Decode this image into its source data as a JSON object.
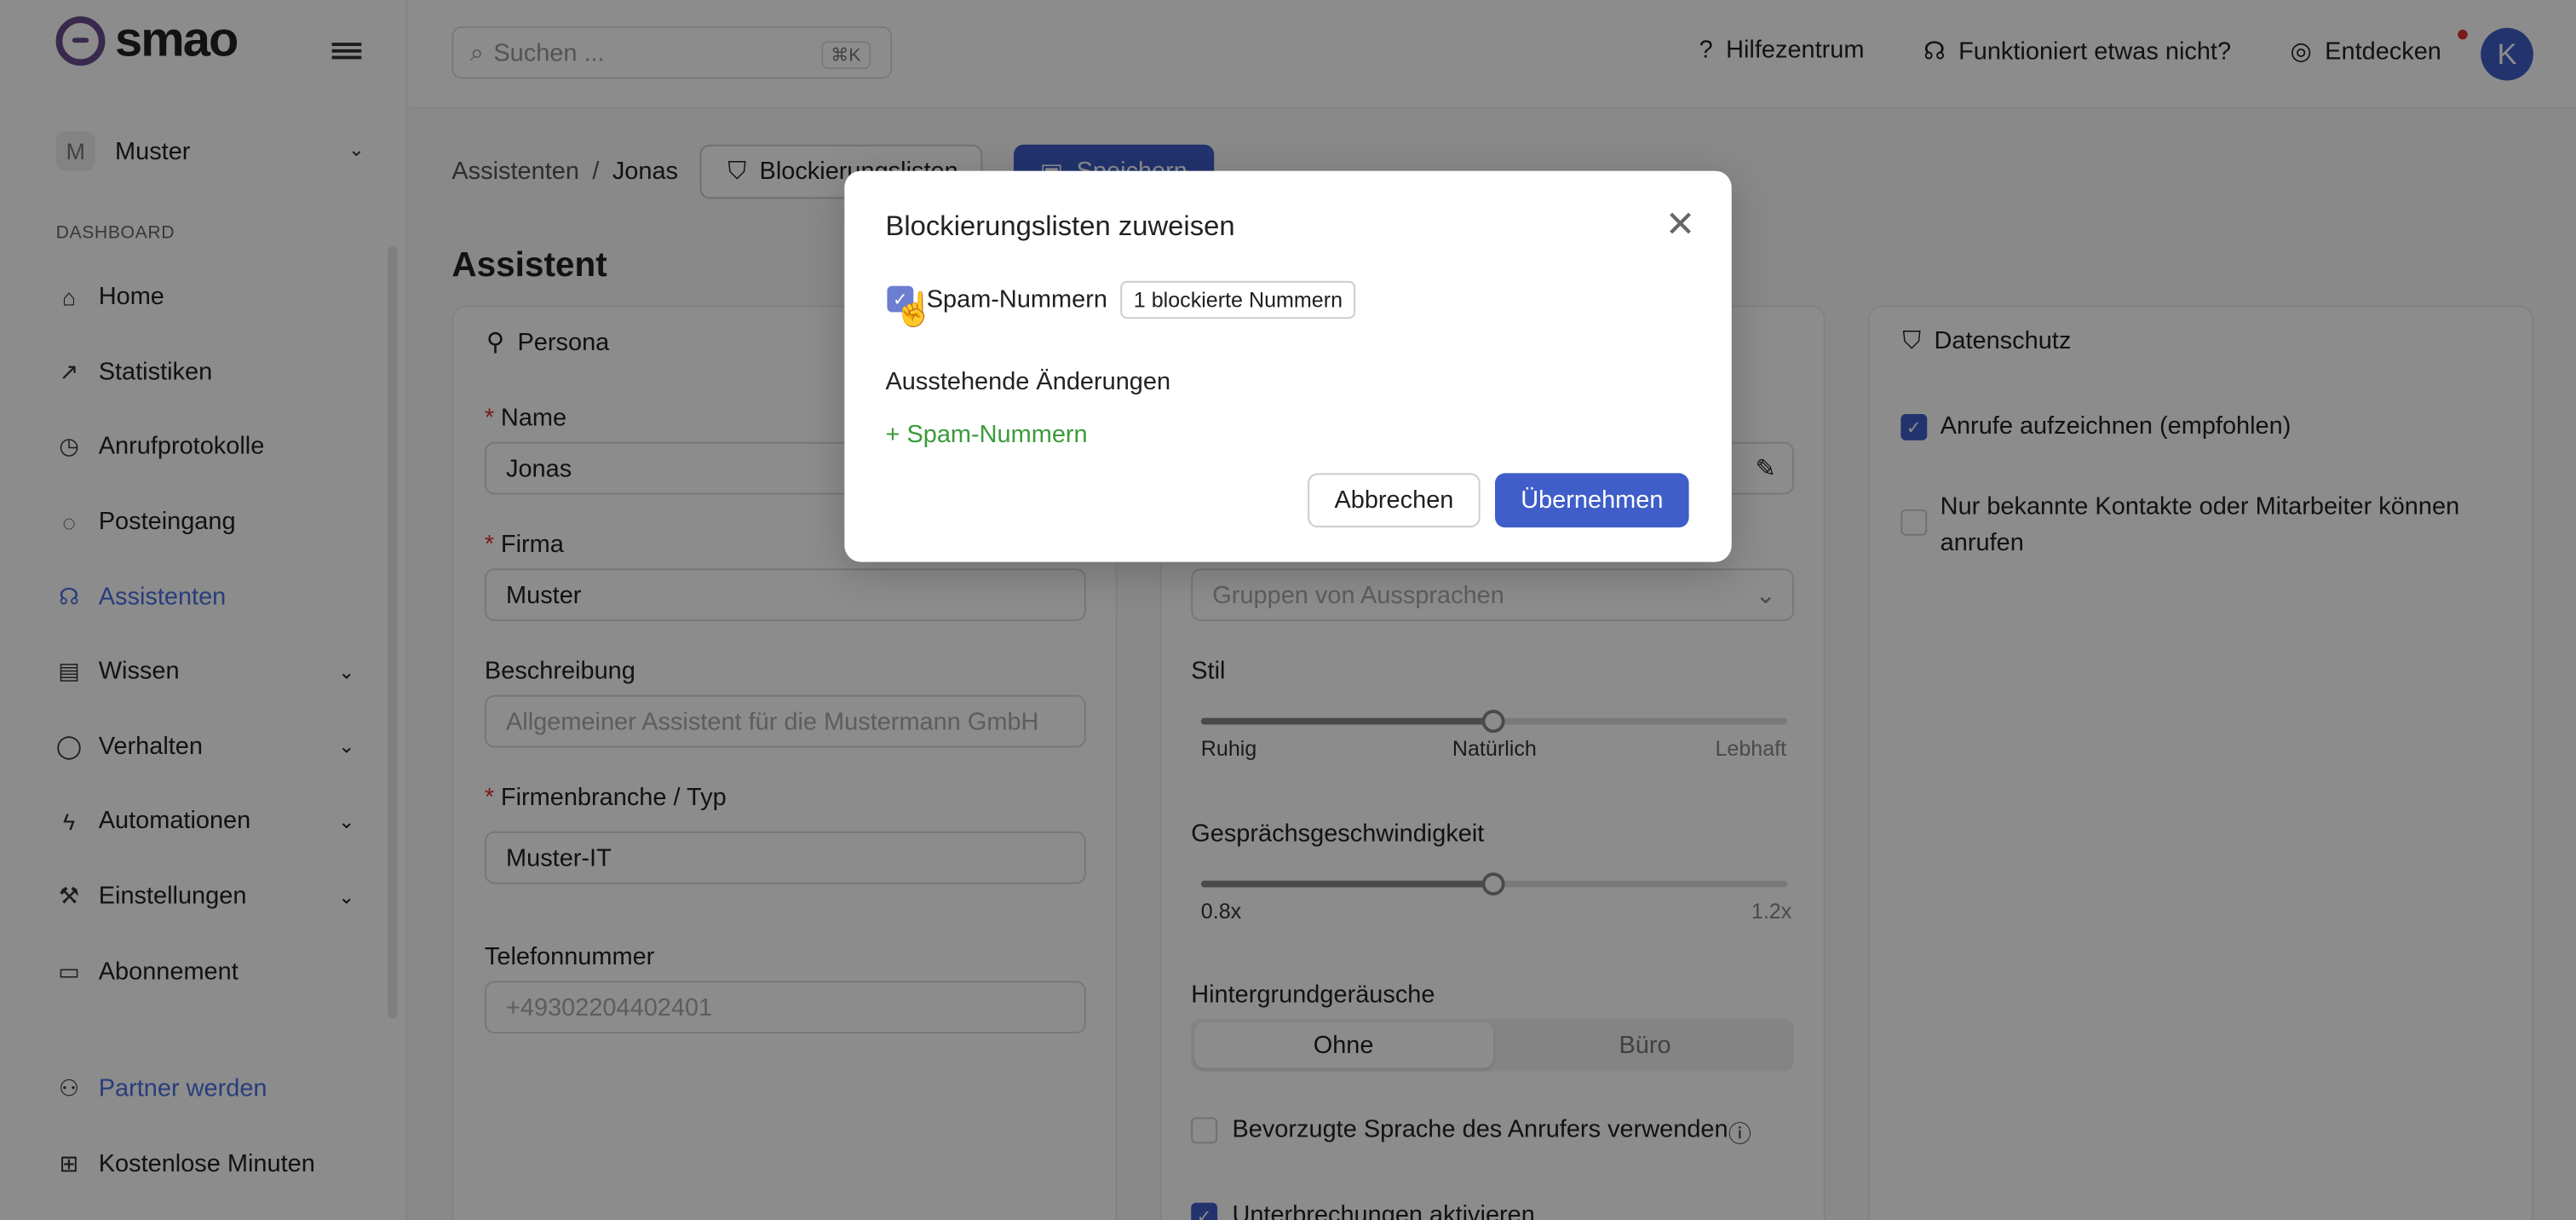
{
  "brand": {
    "name": "smao"
  },
  "org": {
    "initial": "M",
    "name": "Muster"
  },
  "sidebar": {
    "section": "DASHBOARD",
    "items": [
      {
        "label": "Home",
        "icon": "home-icon",
        "glyph": "⌂"
      },
      {
        "label": "Statistiken",
        "icon": "chart-icon",
        "glyph": "↗"
      },
      {
        "label": "Anrufprotokolle",
        "icon": "history-icon",
        "glyph": "◷"
      },
      {
        "label": "Posteingang",
        "icon": "inbox-icon",
        "glyph": "◌"
      },
      {
        "label": "Assistenten",
        "icon": "headset-icon",
        "glyph": "☊",
        "active": true
      },
      {
        "label": "Wissen",
        "icon": "book-icon",
        "glyph": "▤",
        "chevron": true
      },
      {
        "label": "Verhalten",
        "icon": "bulb-icon",
        "glyph": "◯",
        "chevron": true
      },
      {
        "label": "Automationen",
        "icon": "bolt-icon",
        "glyph": "ϟ",
        "chevron": true
      },
      {
        "label": "Einstellungen",
        "icon": "wrench-icon",
        "glyph": "⚒",
        "chevron": true
      },
      {
        "label": "Abonnement",
        "icon": "card-icon",
        "glyph": "▭"
      }
    ],
    "footer": [
      {
        "label": "Partner werden",
        "icon": "users-icon",
        "glyph": "⚇"
      },
      {
        "label": "Kostenlose Minuten",
        "icon": "gift-icon",
        "glyph": "⊞"
      }
    ]
  },
  "topbar": {
    "search_placeholder": "Suchen ...",
    "shortcut": "⌘K",
    "links": [
      {
        "label": "Hilfezentrum",
        "icon": "help-icon",
        "glyph": "?"
      },
      {
        "label": "Funktioniert etwas nicht?",
        "icon": "headphones-icon",
        "glyph": "☊"
      },
      {
        "label": "Entdecken",
        "icon": "compass-icon",
        "glyph": "◎"
      }
    ],
    "avatar": "K"
  },
  "breadcrumb": {
    "parent": "Assistenten",
    "sep": "/",
    "current": "Jonas"
  },
  "actions": {
    "blocklists": "Blockierungslisten",
    "save": "Speichern"
  },
  "page_title": "Assistent",
  "persona": {
    "title": "Persona",
    "name_label": "Name",
    "name_value": "Jonas",
    "company_label": "Firma",
    "company_value": "Muster",
    "desc_label": "Beschreibung",
    "desc_placeholder": "Allgemeiner Assistent für die Mustermann GmbH",
    "industry_label": "Firmenbranche / Typ",
    "industry_value": "Muster-IT",
    "phone_label": "Telefonnummer",
    "phone_placeholder": "+49302204402401"
  },
  "voice": {
    "pron_placeholder": "Gruppen von Aussprachen",
    "style_label": "Stil",
    "style_min": "Ruhig",
    "style_mid": "Natürlich",
    "style_max": "Lebhaft",
    "style_value": 0.5,
    "speed_label": "Gesprächsgeschwindigkeit",
    "speed_min": "0.8x",
    "speed_max": "1.2x",
    "speed_value": 0.5,
    "noise_label": "Hintergrundgeräusche",
    "noise_on": "Ohne",
    "noise_off": "Büro",
    "lang_label": "Bevorzugte Sprache des Anrufers verwenden",
    "interrupt_label": "Unterbrechungen aktivieren"
  },
  "privacy": {
    "title": "Datenschutz",
    "record_label": "Anrufe aufzeichnen (empfohlen)",
    "known_label": "Nur bekannte Kontakte oder Mitarbeiter können anrufen"
  },
  "modal": {
    "title": "Blockierungslisten zuweisen",
    "item_label": "Spam-Nummern",
    "item_count": "1 blockierte Nummern",
    "pending_title": "Ausstehende Änderungen",
    "pending_item": "+ Spam-Nummern",
    "cancel": "Abbrechen",
    "apply": "Übernehmen"
  }
}
